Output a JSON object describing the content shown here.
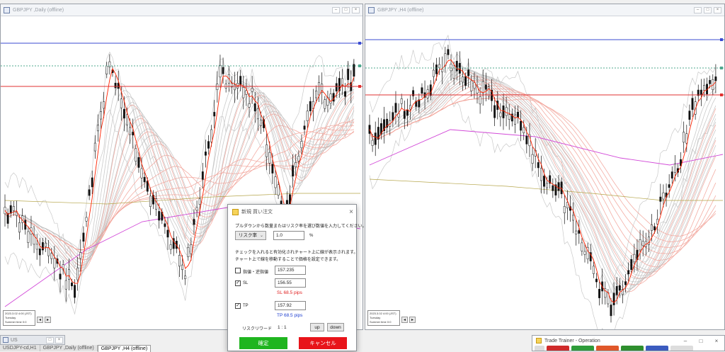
{
  "left_window": {
    "title": "GBPJPY ,Daily (offline)",
    "info": [
      "2023.3.02 4:00 (JST)",
      "Tuesday",
      "Summer time 0:0"
    ]
  },
  "right_window": {
    "title": "GBPJPY ,H4 (offline)",
    "info": [
      "2023.3.02 4:00 (JST)",
      "Tuesday",
      "Summer time 0:0"
    ]
  },
  "minimized_window": {
    "title": "US"
  },
  "tabs": [
    "USDJPY-cd,H1",
    "GBPJPY ,Daily (offline)",
    "GBPJPY ,H4 (offline)"
  ],
  "dialog": {
    "title": "新規 買い注文",
    "instruction": "プルダウンから数量またはリスク率を選び数値を入力してください。",
    "select_value": "リスク率",
    "risk_value": "1.0",
    "percent_unit": "%",
    "note1": "チェックを入れると有効化されチャート上に線が表示されます。",
    "note2": "チャート上で線を移動することで価格を設定できます。",
    "limit_label": "指値・逆指値",
    "limit_value": "157.235",
    "sl_label": "SL",
    "sl_value": "156.55",
    "sl_pips": "SL 68.5 pips",
    "tp_label": "TP",
    "tp_value": "157.92",
    "tp_pips": "TP 68.5 pips",
    "rr_label": "リスクリワード",
    "rr_value": "1 : 1",
    "up_label": "up",
    "down_label": "down",
    "confirm_label": "確定",
    "cancel_label": "キャンセル"
  },
  "trade_trainer": {
    "title": "Trade Trainer - Operation"
  },
  "colors": {
    "candle": "#111111",
    "ema_red": "#ff2200",
    "ribbon_red": "#f2a49a",
    "ribbon_gray": "#bdbdbd",
    "line_blue": "#3a4bd1",
    "line_red": "#e03030",
    "line_teal": "#4fa88f",
    "confirm_green": "#1fb51f",
    "cancel_red": "#e8141a"
  }
}
